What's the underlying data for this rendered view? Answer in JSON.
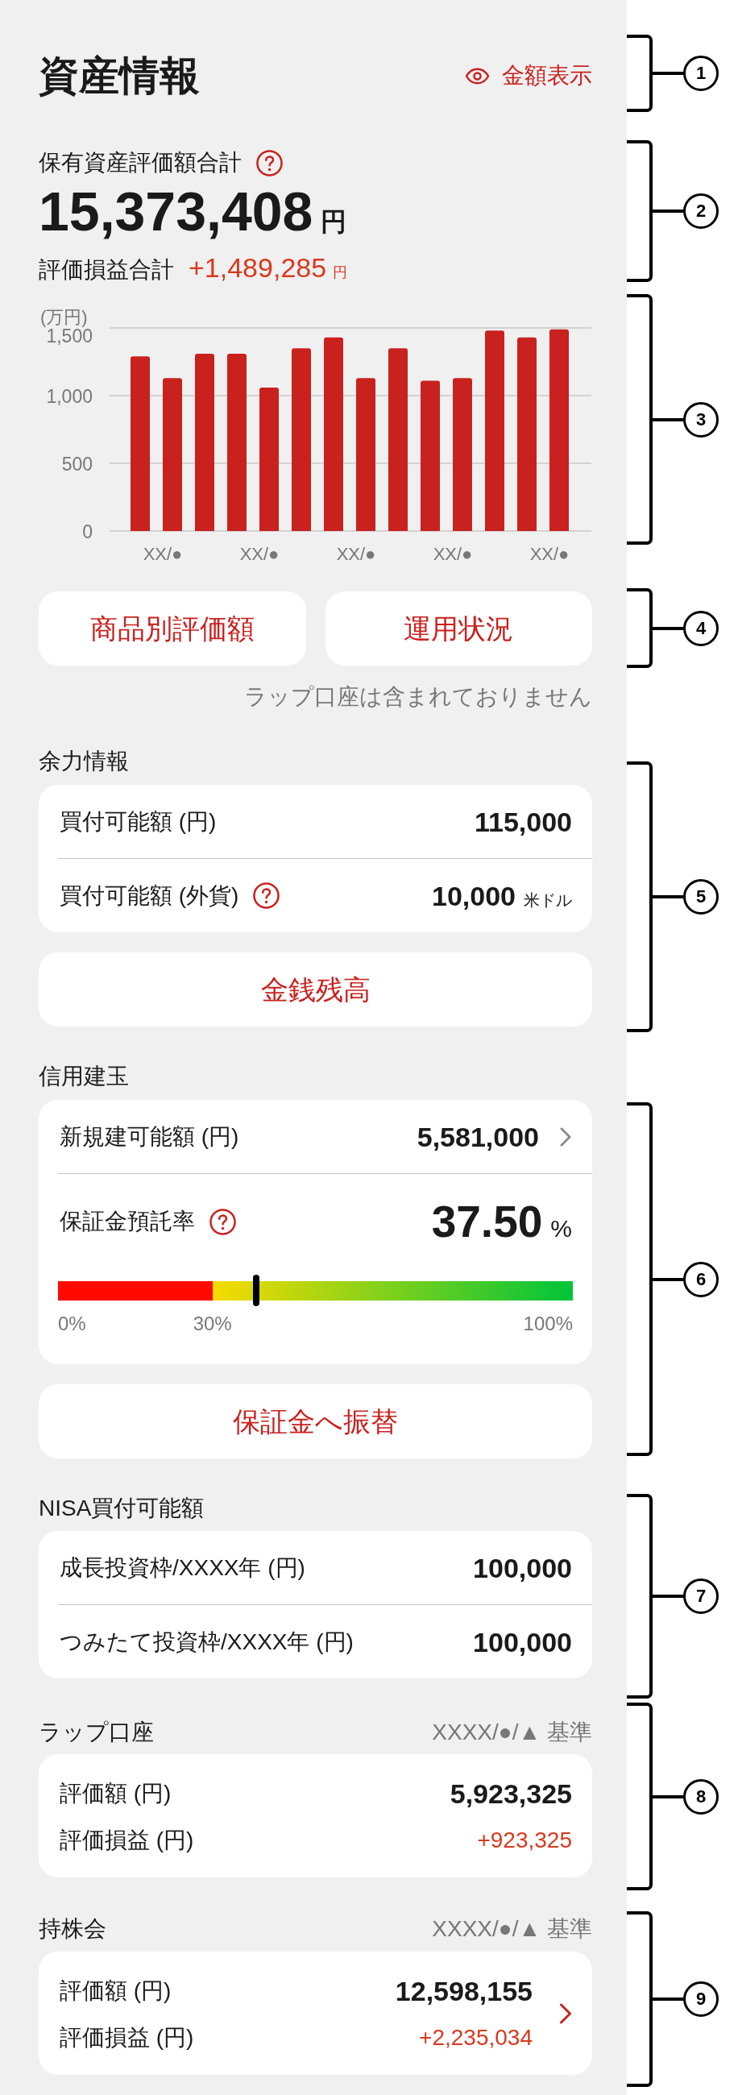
{
  "header": {
    "title": "資産情報",
    "toggle_label": "金額表示"
  },
  "totals": {
    "label": "保有資産評価額合計",
    "help": true,
    "amount": "15,373,408",
    "amount_unit": "円",
    "pnl_label": "評価損益合計",
    "pnl": "+1,489,285",
    "pnl_unit": "円"
  },
  "chart": {
    "chart_data": {
      "type": "bar",
      "ylabel": "(万円)",
      "categories": [
        null,
        "XX/●",
        null,
        null,
        "XX/●",
        null,
        null,
        "XX/●",
        null,
        null,
        "XX/●",
        null,
        null,
        "XX/●"
      ],
      "values": [
        1290,
        1130,
        1310,
        1310,
        1060,
        1350,
        1430,
        1130,
        1350,
        1110,
        1130,
        1480,
        1430,
        1490
      ],
      "yticks": [
        {
          "value": 0,
          "label": "0"
        },
        {
          "value": 500,
          "label": "500"
        },
        {
          "value": 1000,
          "label": "1,000"
        },
        {
          "value": 1500,
          "label": "1,500"
        }
      ],
      "ylim": [
        0,
        1500
      ]
    }
  },
  "quick_buttons": [
    {
      "label": "商品別評価額"
    },
    {
      "label": "運用状況"
    }
  ],
  "note": "ラップ口座は含まれておりません",
  "buying_power": {
    "title": "余力情報",
    "rows": [
      {
        "label": "買付可能額 (円)",
        "value": "115,000"
      },
      {
        "label": "買付可能額 (外貨)",
        "help": true,
        "value": "10,000",
        "unit": "米ドル"
      }
    ],
    "button": "金銭残高"
  },
  "margin": {
    "title": "信用建玉",
    "new_position": {
      "label": "新規建可能額 (円)",
      "value": "5,581,000",
      "link": true
    },
    "deposit_rate": {
      "label": "保証金預託率",
      "help": true,
      "value": "37.50",
      "unit": "%",
      "level": 0.385,
      "scale_labels": [
        "0%",
        "30%",
        "100%"
      ]
    },
    "button": "保証金へ振替"
  },
  "nisa": {
    "title": "NISA買付可能額",
    "rows": [
      {
        "label": "成長投資枠/XXXX年 (円)",
        "value": "100,000"
      },
      {
        "label": "つみたて投資枠/XXXX年 (円)",
        "value": "100,000"
      }
    ]
  },
  "wrap_account": {
    "title": "ラップ口座",
    "as_of": "XXXX/●/▲ 基準",
    "valuation_label": "評価額 (円)",
    "valuation": "5,923,325",
    "pnl_label": "評価損益 (円)",
    "pnl": "+923,325"
  },
  "stock_club": {
    "title": "持株会",
    "as_of": "XXXX/●/▲ 基準",
    "valuation_label": "評価額 (円)",
    "valuation": "12,598,155",
    "pnl_label": "評価損益 (円)",
    "pnl": "+2,235,034",
    "link": true
  },
  "callouts": [
    "1",
    "2",
    "3",
    "4",
    "5",
    "6",
    "7",
    "8",
    "9"
  ]
}
